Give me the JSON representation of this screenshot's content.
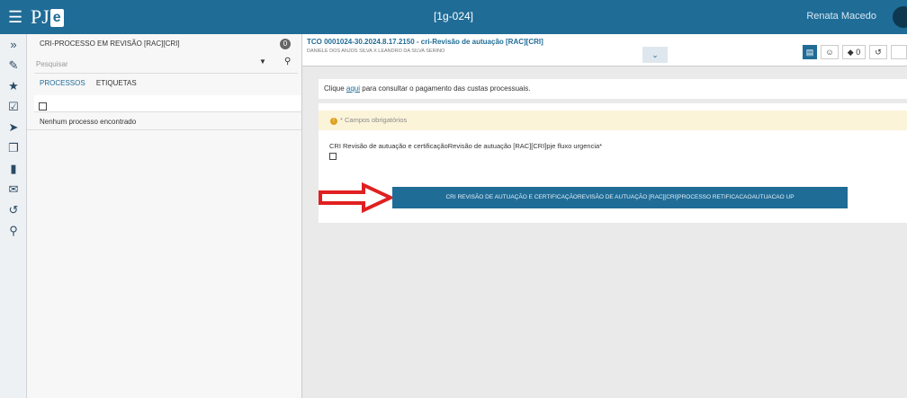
{
  "topbar": {
    "menu_icon": "hamburger-icon",
    "logo_text": "PJ",
    "logo_e": "e",
    "center_title": "[1g-024]",
    "user_name": "Renata Macedo"
  },
  "rail": {
    "icons": [
      "double-chevron-right-icon",
      "pencil-icon",
      "star-icon",
      "check-square-icon",
      "tags-icon",
      "copy-icon",
      "folder-icon",
      "envelope-icon",
      "history-icon",
      "search-icon"
    ]
  },
  "panel": {
    "title": "CRI-PROCESSO EM REVISÃO [RAC][CRI]",
    "badge": "0",
    "search_placeholder": "Pesquisar",
    "tabs": [
      "PROCESSOS",
      "ETIQUETAS"
    ],
    "empty_message": "Nenhum processo encontrado"
  },
  "process": {
    "title": "TCO 0001024-30.2024.8.17.2150 - cri-Revisão de autuação [RAC][CRI]",
    "subtitle": "DANIELE DOS ANJOS SILVA X LEANDRO DA SILVA SERINO",
    "toolbar_badge": "0"
  },
  "main": {
    "info_before": "Clique ",
    "info_link": "aqui",
    "info_after": " para consultar o pagamento das custas processuais.",
    "required_note": "* Campos obrigatórios",
    "field_label": "CRI Revisão de autuação e certificaçãoRevisão de autuação [RAC][CRI]pje fluxo urgencia*",
    "action_button": "CRI REVISÃO DE AUTUAÇÃO E CERTIFICAÇÃOREVISÃO DE AUTUAÇÃO [RAC][CRI]PROCESSO RETIFICACAOAUTUACAO UP"
  },
  "colors": {
    "brand": "#1f6c97",
    "warning_bg": "#fcf4d9",
    "arrow": "#e02020"
  }
}
